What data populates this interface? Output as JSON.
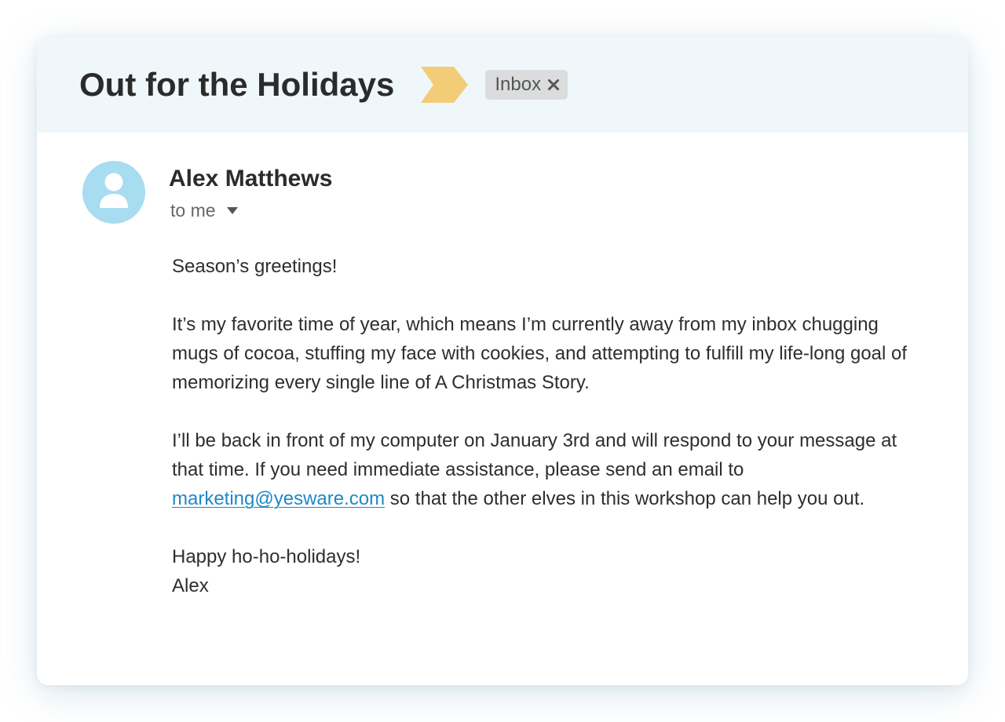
{
  "email": {
    "subject": "Out for the Holidays",
    "label": "Inbox",
    "importance_marker_color": "#f2cc76",
    "avatar_color": "#a8dcf0",
    "link_color": "#1e88c7",
    "sender": {
      "name": "Alex Matthews",
      "recipient": "to me"
    },
    "body": {
      "greeting": "Season’s greetings!",
      "paragraph1": "It’s my favorite time of year, which means I’m currently away from my inbox chugging mugs of cocoa, stuffing my face with cookies, and attempting to fulfill my life-long goal of memorizing every single line of A Christmas Story.",
      "paragraph2_before_link": "I’ll be back in front of my computer on January 3rd and will respond to your message at that time. If you need immediate assistance, please send an email to ",
      "link_text": "marketing@yesware.com",
      "paragraph2_after_link": " so that the other elves in this workshop can help you out.",
      "closing": "Happy ho-ho-holidays!",
      "signature": "Alex"
    }
  }
}
